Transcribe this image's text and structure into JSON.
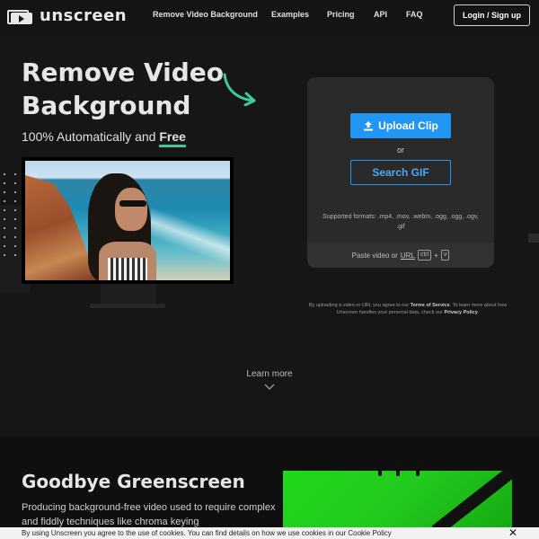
{
  "nav": {
    "brand": "unscreen",
    "links": [
      "Remove Video Background",
      "Examples",
      "Pricing",
      "API",
      "FAQ"
    ],
    "login_label": "Login / Sign up"
  },
  "hero": {
    "title": "Remove Video Background",
    "subtitle_prefix": "100% Automatically and ",
    "subtitle_highlight": "Free",
    "accent_color": "#3ec9a7"
  },
  "upload": {
    "upload_label": "Upload Clip",
    "or_label": "or",
    "gif_label": "Search GIF",
    "formats": "Supported formats: .mp4, .mov, .webm, .ogg, .ogg, .ogv, .gif",
    "paste_prefix": "Paste video or",
    "paste_url": "URL",
    "key_ctrl": "ctrl",
    "key_plus": "+",
    "key_v": "v",
    "button_color": "#2196f3"
  },
  "terms": {
    "part1": "By uploading a video or URL you agree to our ",
    "tos": "Terms of Service",
    "part2": ". To learn more about how Unscreen handles your personal data, check our ",
    "privacy": "Privacy Policy",
    "part3": "."
  },
  "learn_more": "Learn more",
  "section2": {
    "title": "Goodbye Greenscreen",
    "text": "Producing background-free video used to require complex and fiddly techniques like chroma keying"
  },
  "cookie": {
    "text": "By using Unscreen you agree to the use of cookies. You can find details on how we use cookies in our Cookie Policy"
  },
  "icons": [
    "video-logo-icon",
    "curved-arrow-icon",
    "upload-icon",
    "chevron-down-icon",
    "close-icon"
  ]
}
